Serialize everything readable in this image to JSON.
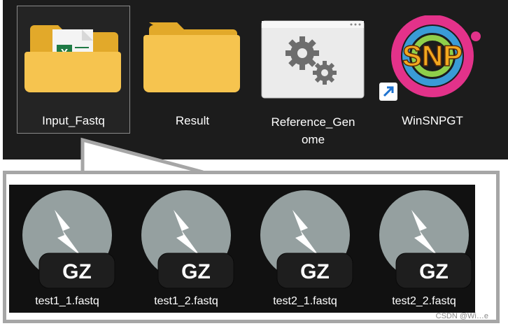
{
  "desktop_icons": [
    {
      "label": "Input_Fastq",
      "icon": "folder-with-spreadsheet-icon"
    },
    {
      "label": "Result",
      "icon": "folder-icon"
    },
    {
      "label_line1": "Reference_Gen",
      "label_line2": "ome",
      "icon": "settings-file-icon"
    },
    {
      "label": "WinSNPGT",
      "icon": "app-shortcut-icon",
      "logo_text": "SNP"
    }
  ],
  "files": [
    {
      "label": "test1_1.fastq",
      "badge": "GZ"
    },
    {
      "label": "test1_2.fastq",
      "badge": "GZ"
    },
    {
      "label": "test2_1.fastq",
      "badge": "GZ"
    },
    {
      "label": "test2_2.fastq",
      "badge": "GZ"
    }
  ],
  "watermark": "CSDN @Wi…e",
  "colors": {
    "folder": "#f6c44f",
    "folder_back": "#e2a92a",
    "gz_circle": "#95a0a0",
    "gz_badge": "#1e1e1e",
    "callout_border": "#a6a6a6"
  }
}
